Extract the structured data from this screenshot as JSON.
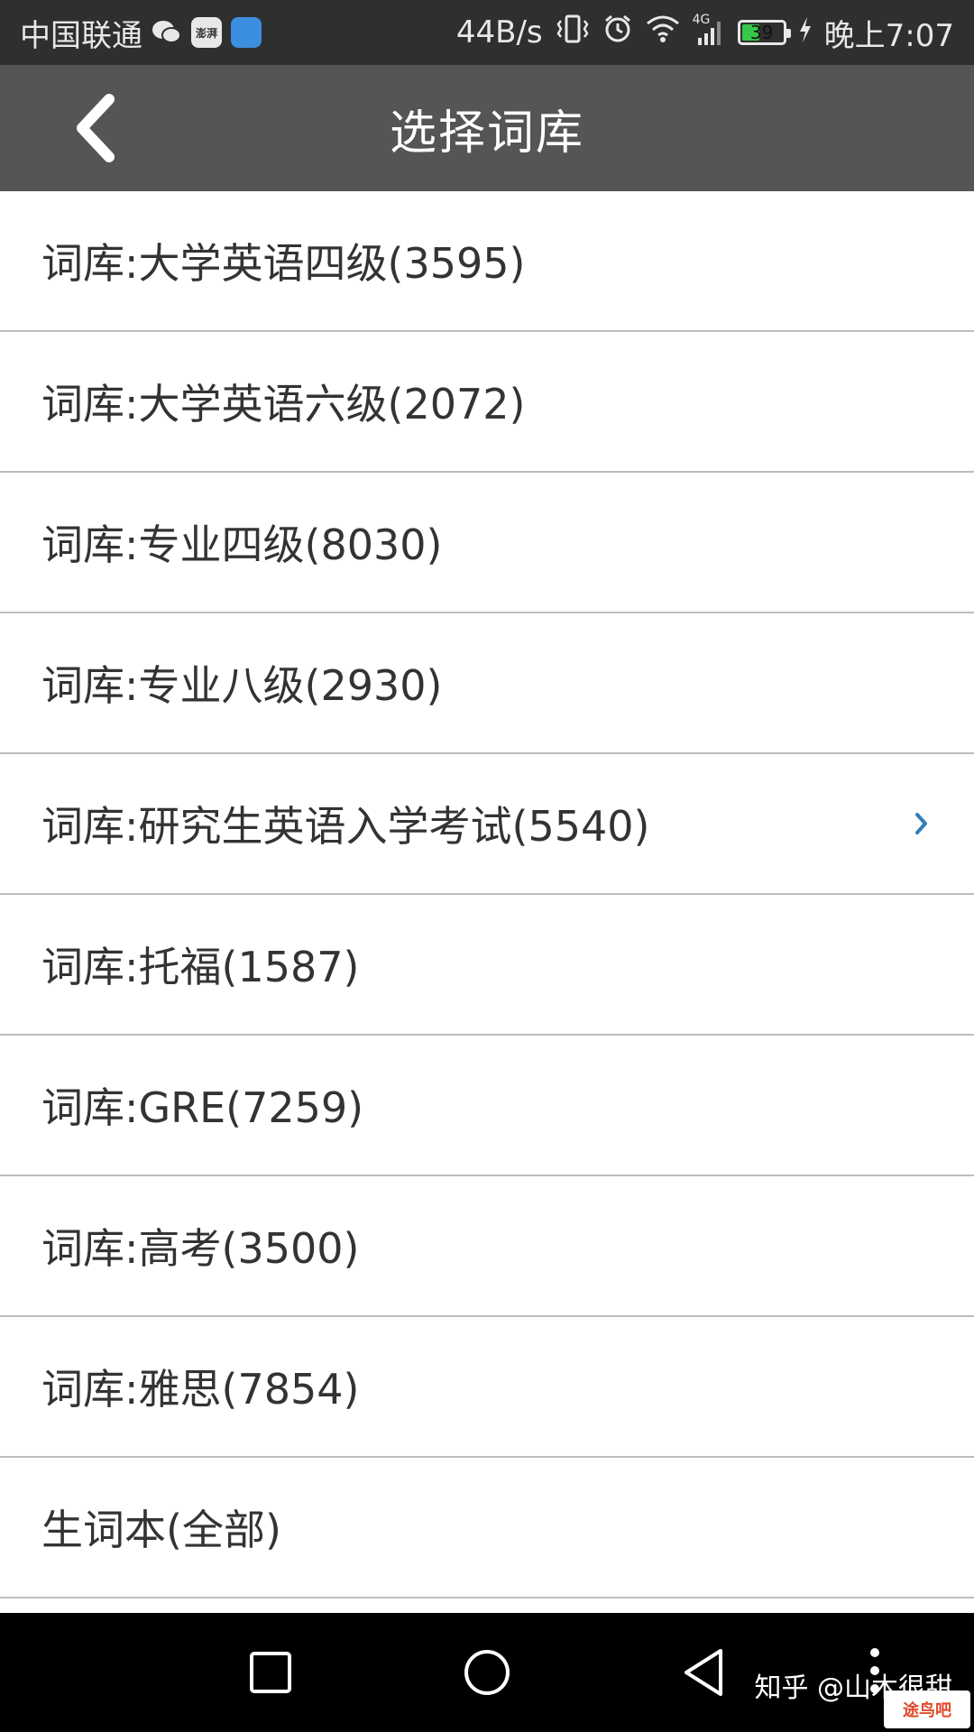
{
  "status_bar": {
    "carrier": "中国联通",
    "speed": "44B/s",
    "network": "4G",
    "battery": "39",
    "time": "晚上7:07",
    "app_icons": [
      "wechat-icon",
      "tts-app-icon",
      "blue-app-icon"
    ],
    "tts_icon_text": "澎湃"
  },
  "header": {
    "title": "选择词库"
  },
  "list": {
    "items": [
      {
        "label": "词库:大学英语四级(3595)"
      },
      {
        "label": "词库:大学英语六级(2072)"
      },
      {
        "label": "词库:专业四级(8030)"
      },
      {
        "label": "词库:专业八级(2930)"
      },
      {
        "label": "词库:研究生英语入学考试(5540)",
        "selected": true
      },
      {
        "label": "词库:托福(1587)"
      },
      {
        "label": "词库:GRE(7259)"
      },
      {
        "label": "词库:高考(3500)"
      },
      {
        "label": "词库:雅思(7854)"
      },
      {
        "label": "生词本(全部)"
      }
    ]
  },
  "watermark": {
    "text": "知乎 @山木很甜",
    "badge": "途鸟吧"
  },
  "colors": {
    "status_bg": "#2f2f2f",
    "header_bg": "#555555",
    "divider": "#bdbdbd",
    "text": "#333333",
    "chevron": "#2f7fb8",
    "nav_bg": "#000000"
  }
}
